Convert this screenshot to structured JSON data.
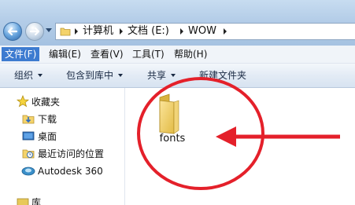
{
  "breadcrumb": {
    "segments": [
      "计算机",
      "文档 (E:)",
      "WOW"
    ]
  },
  "menu": {
    "items": [
      "文件(F)",
      "编辑(E)",
      "查看(V)",
      "工具(T)",
      "帮助(H)"
    ]
  },
  "toolbar": {
    "organize": "组织",
    "include_in_library": "包含到库中",
    "share": "共享",
    "new_folder": "新建文件夹"
  },
  "navigation": {
    "favorites_label": "收藏夹",
    "items": [
      "下载",
      "桌面",
      "最近访问的位置",
      "Autodesk 360"
    ],
    "partial_label": "库"
  },
  "content": {
    "folder": {
      "name": "fonts",
      "icon": "folder-icon"
    }
  },
  "annotation": {
    "circle_color": "#e4202a",
    "arrow_color": "#e4202a"
  },
  "colors": {
    "menu_active": "#3d7bd0",
    "folder": "#f2d46a"
  }
}
